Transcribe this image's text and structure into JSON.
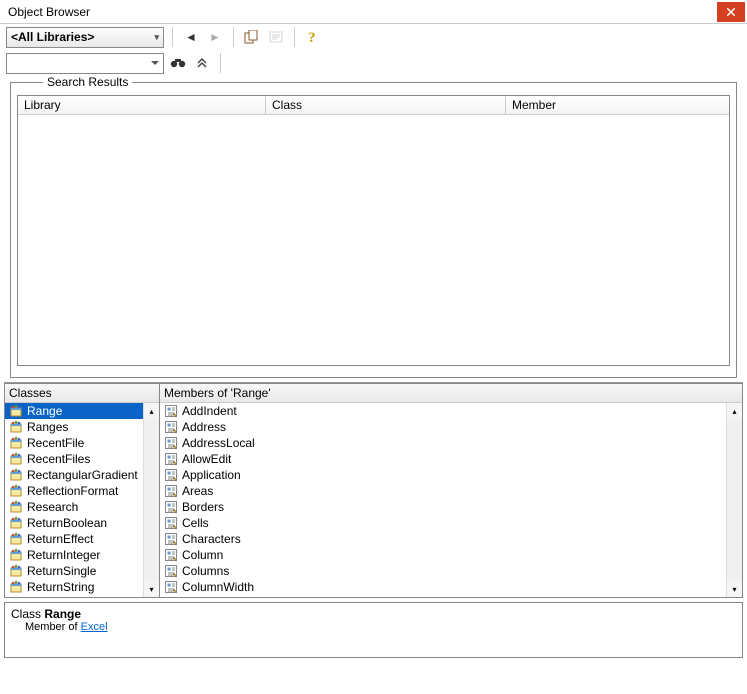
{
  "window": {
    "title": "Object Browser"
  },
  "toolbar": {
    "library_dropdown": "<All Libraries>",
    "search_value": ""
  },
  "search_results": {
    "legend": "Search Results",
    "columns": {
      "library": "Library",
      "class": "Class",
      "member": "Member"
    }
  },
  "classes_pane": {
    "header": "Classes",
    "items": [
      {
        "name": "Range",
        "selected": true
      },
      {
        "name": "Ranges"
      },
      {
        "name": "RecentFile"
      },
      {
        "name": "RecentFiles"
      },
      {
        "name": "RectangularGradient"
      },
      {
        "name": "ReflectionFormat"
      },
      {
        "name": "Research"
      },
      {
        "name": "ReturnBoolean"
      },
      {
        "name": "ReturnEffect"
      },
      {
        "name": "ReturnInteger"
      },
      {
        "name": "ReturnSingle"
      },
      {
        "name": "ReturnString"
      }
    ]
  },
  "members_pane": {
    "header": "Members of 'Range'",
    "items": [
      {
        "name": "AddIndent"
      },
      {
        "name": "Address"
      },
      {
        "name": "AddressLocal"
      },
      {
        "name": "AllowEdit"
      },
      {
        "name": "Application"
      },
      {
        "name": "Areas"
      },
      {
        "name": "Borders"
      },
      {
        "name": "Cells"
      },
      {
        "name": "Characters"
      },
      {
        "name": "Column"
      },
      {
        "name": "Columns"
      },
      {
        "name": "ColumnWidth"
      }
    ]
  },
  "detail": {
    "prefix": "Class",
    "class_name": "Range",
    "member_prefix": "Member of",
    "member_link": "Excel"
  }
}
